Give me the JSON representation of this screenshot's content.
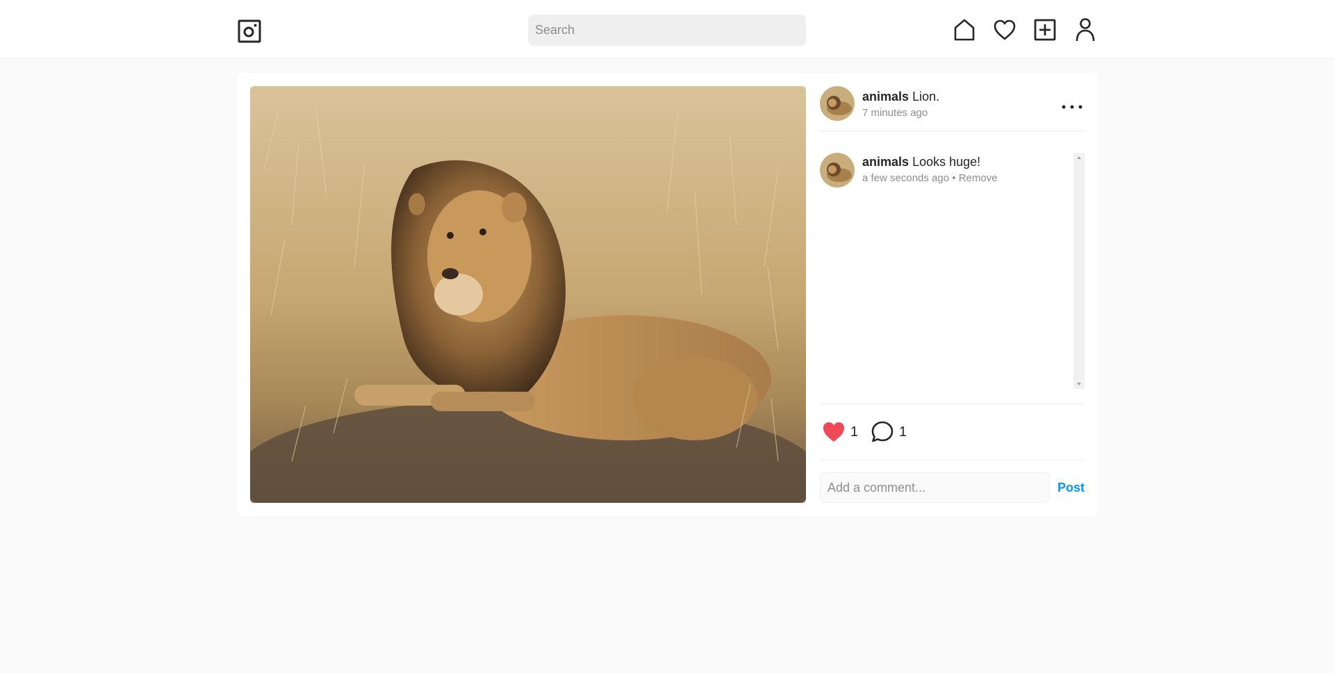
{
  "nav": {
    "search_placeholder": "Search",
    "icons": [
      "camera-logo-icon",
      "home-icon",
      "heart-icon",
      "add-post-icon",
      "profile-icon"
    ]
  },
  "post": {
    "username": "animals",
    "caption": "Lion.",
    "time": "7 minutes ago",
    "likes": "1",
    "comment_count": "1"
  },
  "comments": [
    {
      "username": "animals",
      "text": "Looks huge!",
      "time": "a few seconds ago",
      "separator": "•",
      "remove_label": "Remove"
    }
  ],
  "composer": {
    "placeholder": "Add a comment...",
    "post_label": "Post"
  },
  "colors": {
    "accent": "#0095f6",
    "like": "#ed4956",
    "background": "#fafafa"
  }
}
